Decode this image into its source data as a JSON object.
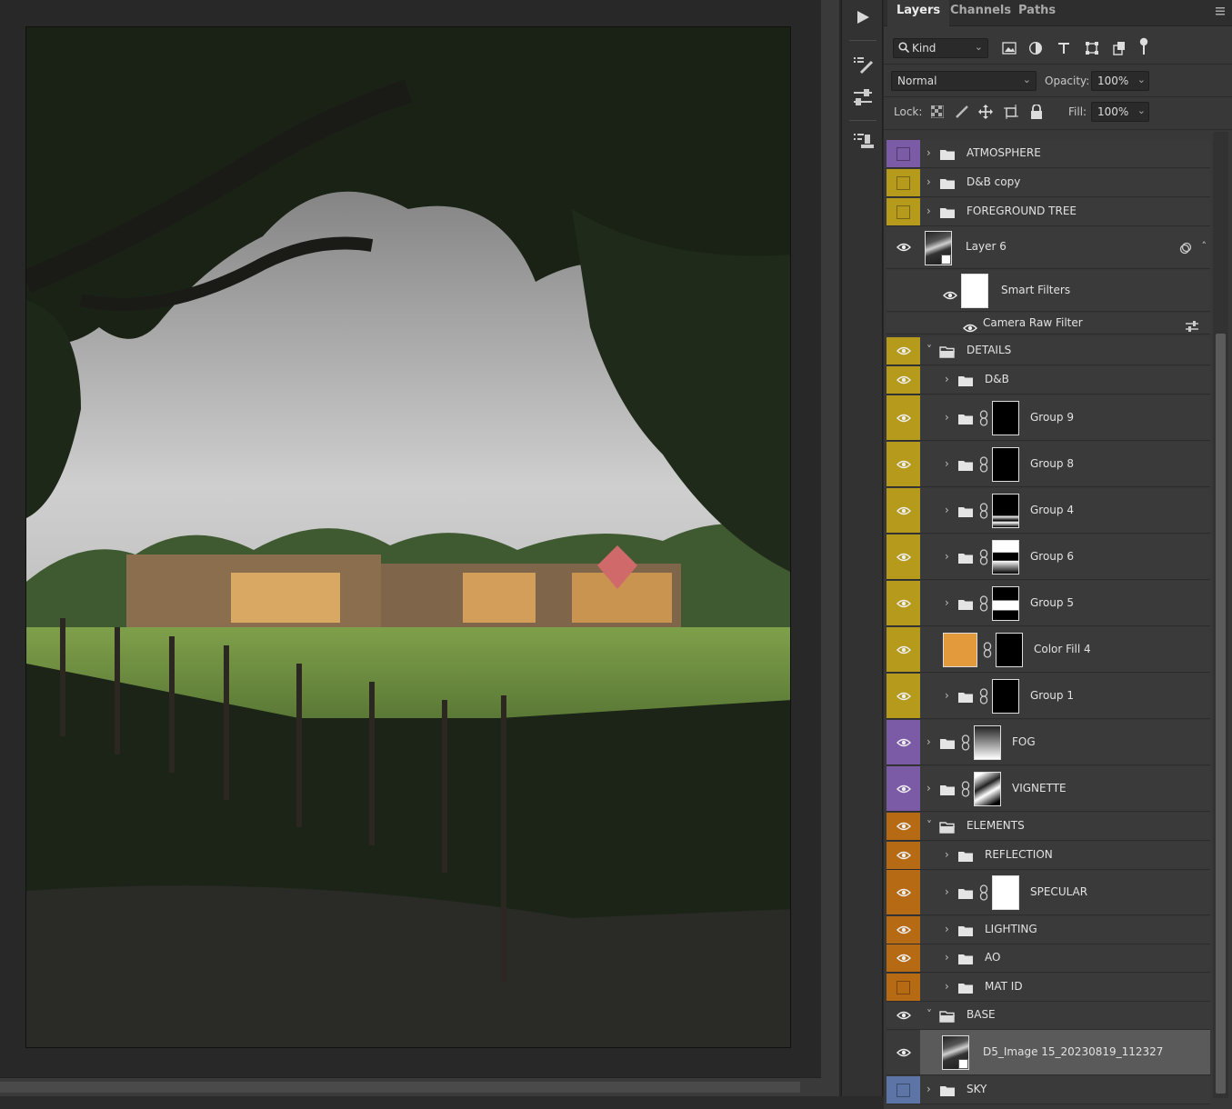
{
  "panel": {
    "tabs": [
      {
        "label": "Layers",
        "active": true
      },
      {
        "label": "Channels",
        "active": false
      },
      {
        "label": "Paths",
        "active": false
      }
    ],
    "filter": {
      "label": "Kind"
    },
    "blend_mode": "Normal",
    "opacity_label": "Opacity:",
    "opacity_value": "100%",
    "lock_label": "Lock:",
    "fill_label": "Fill:",
    "fill_value": "100%"
  },
  "layers": [
    {
      "name": "ATMOSPHERE",
      "type": "group",
      "color": "purple",
      "visible": false,
      "expanded": false
    },
    {
      "name": "D&B copy",
      "type": "group",
      "color": "yellow",
      "visible": false,
      "expanded": false
    },
    {
      "name": "FOREGROUND TREE",
      "type": "group",
      "color": "yellow",
      "visible": false,
      "expanded": false
    },
    {
      "name": "Layer 6",
      "type": "smart-object",
      "color": "none",
      "visible": true
    },
    {
      "name": "Smart Filters",
      "type": "smart-filters",
      "visible": true
    },
    {
      "name": "Camera Raw Filter",
      "type": "filter",
      "visible": true
    },
    {
      "name": "DETAILS",
      "type": "group",
      "color": "yellow",
      "visible": true,
      "expanded": true
    },
    {
      "name": "D&B",
      "type": "group",
      "color": "yellow",
      "visible": true,
      "expanded": false
    },
    {
      "name": "Group 9",
      "type": "group-mask",
      "color": "yellow",
      "visible": true
    },
    {
      "name": "Group 8",
      "type": "group-mask",
      "color": "yellow",
      "visible": true
    },
    {
      "name": "Group 4",
      "type": "group-mask",
      "color": "yellow",
      "visible": true
    },
    {
      "name": "Group 6",
      "type": "group-mask",
      "color": "yellow",
      "visible": true
    },
    {
      "name": "Group 5",
      "type": "group-mask",
      "color": "yellow",
      "visible": true
    },
    {
      "name": "Color Fill 4",
      "type": "fill",
      "color": "yellow",
      "visible": true,
      "fill_color": "#e29a3c"
    },
    {
      "name": "Group 1",
      "type": "group-mask",
      "color": "yellow",
      "visible": true
    },
    {
      "name": "FOG",
      "type": "group-mask",
      "color": "purple",
      "visible": true
    },
    {
      "name": "VIGNETTE",
      "type": "group-mask",
      "color": "purple",
      "visible": true
    },
    {
      "name": "ELEMENTS",
      "type": "group",
      "color": "orange",
      "visible": true,
      "expanded": true
    },
    {
      "name": "REFLECTION",
      "type": "group",
      "color": "orange",
      "visible": true,
      "expanded": false
    },
    {
      "name": "SPECULAR",
      "type": "group-mask",
      "color": "orange",
      "visible": true
    },
    {
      "name": "LIGHTING",
      "type": "group",
      "color": "orange",
      "visible": true,
      "expanded": false
    },
    {
      "name": "AO",
      "type": "group",
      "color": "orange",
      "visible": true,
      "expanded": false
    },
    {
      "name": "MAT ID",
      "type": "group",
      "color": "orange",
      "visible": false,
      "expanded": false
    },
    {
      "name": "BASE",
      "type": "group",
      "color": "none",
      "visible": true,
      "expanded": true
    },
    {
      "name": "D5_Image 15_20230819_112327",
      "type": "smart-object",
      "color": "none",
      "visible": true,
      "selected": true
    },
    {
      "name": "SKY",
      "type": "group",
      "color": "blue",
      "visible": false,
      "expanded": false
    }
  ],
  "colors": {
    "purple": "#7b5aa6",
    "yellow": "#b59a1c",
    "orange": "#b76a14",
    "blue": "#5d75a6"
  }
}
